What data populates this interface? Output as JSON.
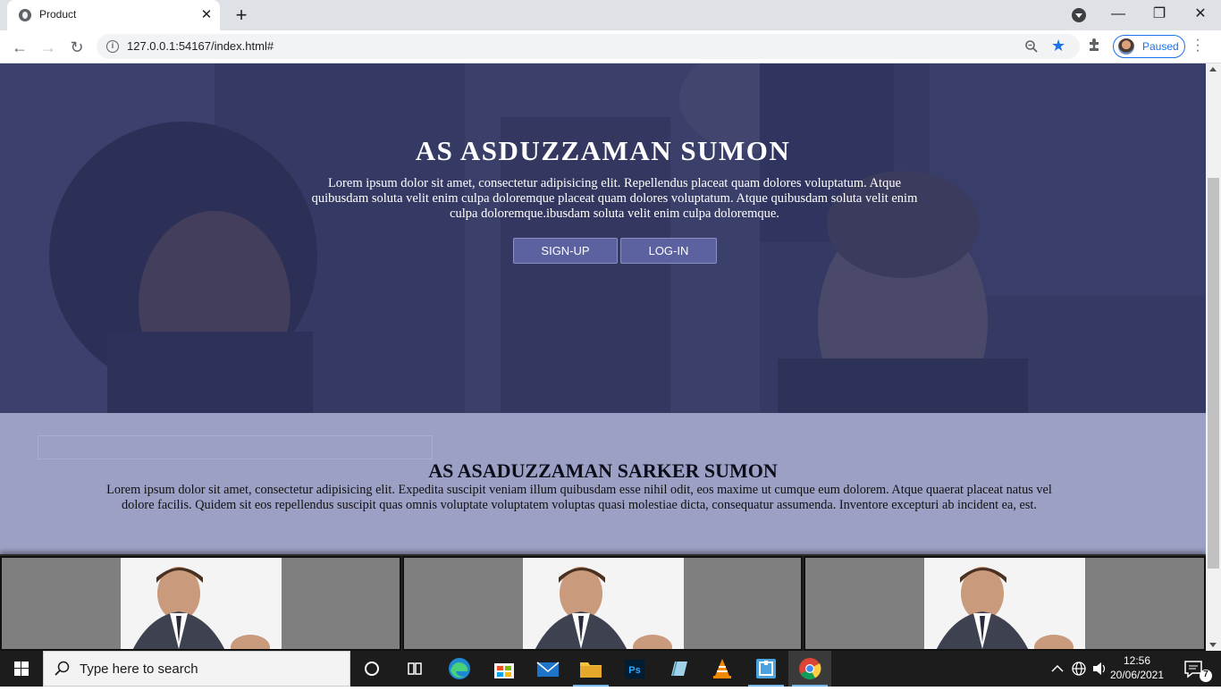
{
  "browser": {
    "tab_title": "Product",
    "tab_close": "✕",
    "new_tab": "+",
    "url": "127.0.0.1:54167/index.html#",
    "profile_status": "Paused",
    "window_controls": {
      "minimize": "—",
      "maximize": "❐",
      "close": "✕"
    },
    "nav": {
      "back": "←",
      "forward": "→",
      "reload": "↻"
    }
  },
  "hero": {
    "title": "AS ASDUZZAMAN SUMON",
    "text": "Lorem ipsum dolor sit amet, consectetur adipisicing elit. Repellendus placeat quam dolores voluptatum. Atque quibusdam soluta velit enim culpa doloremque placeat quam dolores voluptatum. Atque quibusdam soluta velit enim culpa doloremque.ibusdam soluta velit enim culpa doloremque.",
    "signup_label": "SIGN-UP",
    "login_label": "LOG-IN"
  },
  "about": {
    "title": "AS ASADUZZAMAN SARKER SUMON",
    "text": "Lorem ipsum dolor sit amet, consectetur adipisicing elit. Expedita suscipit veniam illum quibusdam esse nihil odit, eos maxime ut cumque eum dolorem. Atque quaerat placeat natus vel dolore facilis. Quidem sit eos repellendus suscipit quas omnis voluptate voluptatem voluptas quasi molestiae dicta, consequatur assumenda. Inventore excepturi ab incident ea, est."
  },
  "taskbar": {
    "search_placeholder": "Type here to search",
    "time": "12:56",
    "date": "20/06/2021",
    "notification_count": "7"
  },
  "colors": {
    "hero_overlay": "#303564",
    "about_bg": "#9ca0c4",
    "button_bg": "#5c62a0",
    "card_bg": "#7f7f7f",
    "accent": "#1a73e8"
  }
}
